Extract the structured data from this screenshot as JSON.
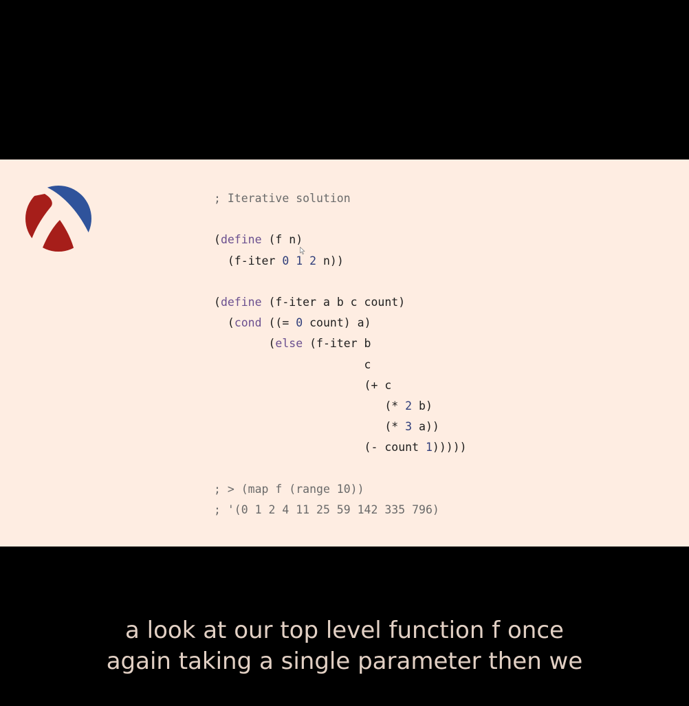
{
  "logo": {
    "icon": "racket-logo-icon",
    "colors": {
      "red": "#a61e1a",
      "blue": "#2f539b"
    }
  },
  "colors": {
    "slide_background": "#feede2",
    "letterbox": "#000000",
    "caption_text": "#e2d0c4"
  },
  "code": {
    "lines": [
      [
        {
          "t": "; Iterative solution",
          "k": "comment"
        }
      ],
      [],
      [
        {
          "t": "(",
          "k": "plain"
        },
        {
          "t": "define",
          "k": "keyword"
        },
        {
          "t": " (f n)",
          "k": "plain"
        }
      ],
      [
        {
          "t": "  (f-iter ",
          "k": "plain"
        },
        {
          "t": "0",
          "k": "number"
        },
        {
          "t": " ",
          "k": "plain"
        },
        {
          "t": "1",
          "k": "number"
        },
        {
          "t": " ",
          "k": "plain"
        },
        {
          "t": "2",
          "k": "number"
        },
        {
          "t": " n))",
          "k": "plain"
        }
      ],
      [],
      [
        {
          "t": "(",
          "k": "plain"
        },
        {
          "t": "define",
          "k": "keyword"
        },
        {
          "t": " (f-iter a b c count)",
          "k": "plain"
        }
      ],
      [
        {
          "t": "  (",
          "k": "plain"
        },
        {
          "t": "cond",
          "k": "keyword"
        },
        {
          "t": " ((= ",
          "k": "plain"
        },
        {
          "t": "0",
          "k": "number"
        },
        {
          "t": " count) a)",
          "k": "plain"
        }
      ],
      [
        {
          "t": "        (",
          "k": "plain"
        },
        {
          "t": "else",
          "k": "keyword"
        },
        {
          "t": " (f-iter b",
          "k": "plain"
        }
      ],
      [
        {
          "t": "                      c",
          "k": "plain"
        }
      ],
      [
        {
          "t": "                      (+ c",
          "k": "plain"
        }
      ],
      [
        {
          "t": "                         (* ",
          "k": "plain"
        },
        {
          "t": "2",
          "k": "number"
        },
        {
          "t": " b)",
          "k": "plain"
        }
      ],
      [
        {
          "t": "                         (* ",
          "k": "plain"
        },
        {
          "t": "3",
          "k": "number"
        },
        {
          "t": " a))",
          "k": "plain"
        }
      ],
      [
        {
          "t": "                      (- count ",
          "k": "plain"
        },
        {
          "t": "1",
          "k": "number"
        },
        {
          "t": ")))))",
          "k": "plain"
        }
      ],
      [],
      [
        {
          "t": "; > (map f (range 10))",
          "k": "comment"
        }
      ],
      [
        {
          "t": "; '(0 1 2 4 11 25 59 142 335 796)",
          "k": "comment"
        }
      ]
    ]
  },
  "captions": {
    "line1": "a look at our top level function f once",
    "line2": "again taking a single parameter then we"
  }
}
